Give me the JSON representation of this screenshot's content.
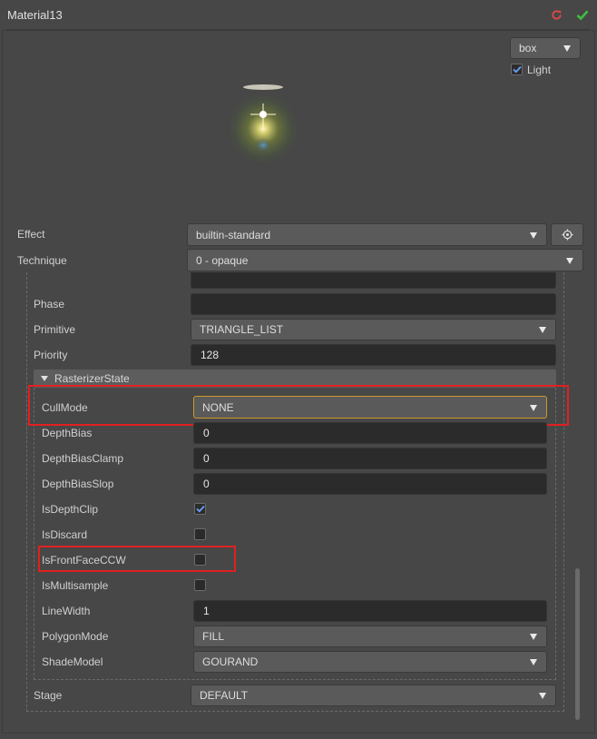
{
  "header": {
    "title": "Material13"
  },
  "preview": {
    "shape_value": "box",
    "light_label": "Light",
    "light_checked": true
  },
  "effect": {
    "label": "Effect",
    "value": "builtin-standard"
  },
  "technique": {
    "label": "Technique",
    "value": "0 - opaque"
  },
  "pass": {
    "phase": {
      "label": "Phase",
      "value": ""
    },
    "primitive": {
      "label": "Primitive",
      "value": "TRIANGLE_LIST"
    },
    "priority": {
      "label": "Priority",
      "value": "128"
    },
    "stage": {
      "label": "Stage",
      "value": "DEFAULT"
    }
  },
  "rasterizer": {
    "title": "RasterizerState",
    "cull_mode": {
      "label": "CullMode",
      "value": "NONE"
    },
    "depth_bias": {
      "label": "DepthBias",
      "value": "0"
    },
    "depth_bias_clamp": {
      "label": "DepthBiasClamp",
      "value": "0"
    },
    "depth_bias_slop": {
      "label": "DepthBiasSlop",
      "value": "0"
    },
    "is_depth_clip": {
      "label": "IsDepthClip",
      "checked": true
    },
    "is_discard": {
      "label": "IsDiscard",
      "checked": false
    },
    "is_front_face_ccw": {
      "label": "IsFrontFaceCCW",
      "checked": false
    },
    "is_multisample": {
      "label": "IsMultisample",
      "checked": false
    },
    "line_width": {
      "label": "LineWidth",
      "value": "1"
    },
    "polygon_mode": {
      "label": "PolygonMode",
      "value": "FILL"
    },
    "shade_model": {
      "label": "ShadeModel",
      "value": "GOURAND"
    }
  },
  "icons": {
    "reset": "reset-icon",
    "apply": "checkmark-icon",
    "locate": "locate-icon"
  },
  "colors": {
    "reset": "#e04848",
    "apply": "#3fbf3f",
    "highlight": "#e02020",
    "focus": "#c99a2b"
  }
}
